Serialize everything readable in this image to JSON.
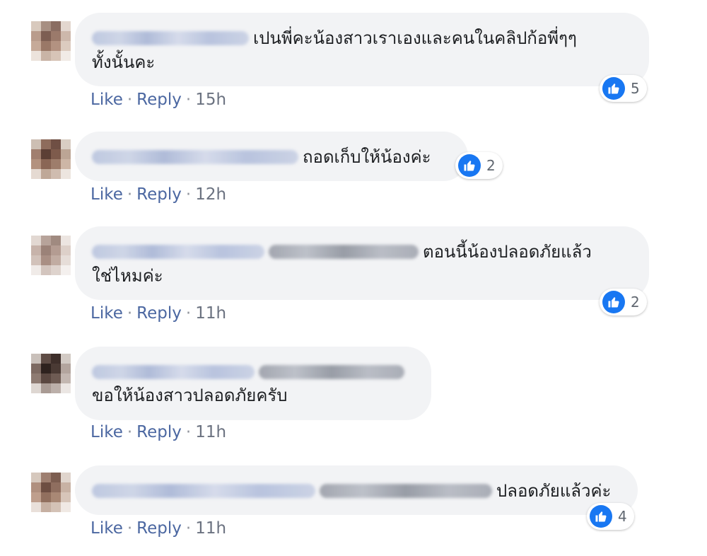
{
  "actions": {
    "like": "Like",
    "reply": "Reply",
    "sep": "·"
  },
  "comments": [
    {
      "text": "เปนพี่คะน้องสาวเราเองและคนในคลิปก้อพี่ๆๆ",
      "text2": "ทั้งนั้นคะ",
      "time": "15h",
      "reactions": "5"
    },
    {
      "text": "ถอดเก็บให้น้องค่ะ",
      "time": "12h",
      "reactions": "2"
    },
    {
      "text": "ตอนนี้น้องปลอดภัยแล้ว",
      "text2": "ใช่ไหมค่ะ",
      "time": "11h",
      "reactions": "2"
    },
    {
      "text": "ขอให้น้องสาวปลอดภัยครับ",
      "time": "11h"
    },
    {
      "text": "ปลอดภัยแล้วค่ะ",
      "time": "11h",
      "reactions": "4"
    }
  ],
  "colors": {
    "link": "#4b67a1",
    "bubble": "#f2f3f5",
    "like_blue": "#1877f2"
  }
}
